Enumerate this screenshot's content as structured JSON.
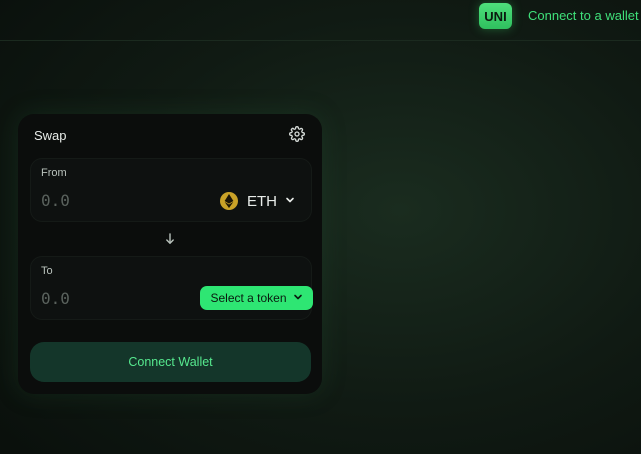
{
  "header": {
    "logo_label": "UNI",
    "connect_link": "Connect to a wallet"
  },
  "swap": {
    "title": "Swap",
    "settings_icon": "gear-icon",
    "from": {
      "label": "From",
      "amount_placeholder": "0.0",
      "token": "ETH",
      "token_icon": "ethereum-icon"
    },
    "swap_arrow_icon": "arrow-down-icon",
    "to": {
      "label": "To",
      "amount_placeholder": "0.0",
      "select_token_label": "Select a token"
    },
    "connect_wallet_label": "Connect Wallet"
  },
  "colors": {
    "accent": "#2ee673",
    "logo_badge": "#3fd06c",
    "connect_button_bg": "#14362a",
    "connect_button_text": "#56e88e",
    "eth_icon": "#c9a227"
  }
}
